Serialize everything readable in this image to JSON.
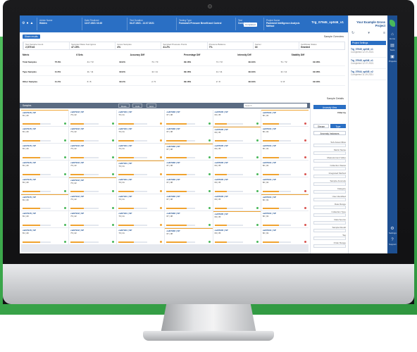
{
  "app": {
    "project_title": "Your Example Gross Project",
    "topbar_title": "Trg_07945_sp046_v1"
  },
  "header": {
    "cells": [
      {
        "key": "Project Name",
        "value": "Pavement Intelligence Analysis Method"
      },
      {
        "key": "Test",
        "value": "Completed"
      },
      {
        "key": "Testing Type",
        "value": "Formwork Pressure Benefit and Control"
      },
      {
        "key": "Test Duration",
        "value": "04.27.2021 - 12.07.2021"
      },
      {
        "key": "Date Finalized",
        "value": "12.07.2021 10:45"
      },
      {
        "key": "Admin Name",
        "value": "Hidden"
      }
    ],
    "tag": "Completed",
    "icons": [
      "bell-icon",
      "user-icon",
      "gear-icon"
    ]
  },
  "sidebar": {
    "rail": [
      {
        "icon": "home-icon",
        "label": "Home"
      },
      {
        "icon": "tests-icon",
        "label": "Tests"
      },
      {
        "icon": "projects-icon",
        "label": "Projects"
      },
      {
        "icon": "settings-icon",
        "label": "Settings"
      },
      {
        "icon": "help-icon",
        "label": "Support"
      }
    ],
    "panel_tab": "Project Settings",
    "projects": [
      {
        "name": "Trg_07945_sp046_v1",
        "sub": "Completed 12.07.2021"
      },
      {
        "name": "Trg_07945_sp046_v1",
        "sub": "Completed 12.07.2021"
      },
      {
        "name": "Trg_07944_sp045_v2",
        "sub": "Completed 11.29.2021"
      }
    ]
  },
  "summary": {
    "button": "Share results",
    "heading": "Sample Overview",
    "metrics": [
      {
        "label": "Test Sample Count",
        "value": "2,575 kit"
      },
      {
        "label": "Sampled Mass Sum/gross",
        "value": "47.15%"
      },
      {
        "label": "Gross Samples",
        "value": "4%"
      },
      {
        "label": "Sampled Pressure Points",
        "value": "41.2%"
      },
      {
        "label": "Pressure Balance",
        "value": "7%"
      },
      {
        "label": "Center",
        "value": "16"
      },
      {
        "label": "Certificate Status",
        "value": "Granted"
      }
    ],
    "stat_headers": [
      "Metric",
      "6 Sets",
      "Accuracy Diff",
      "Percentage Diff",
      "Intensity Diff",
      "Stability Diff"
    ],
    "stat_rows": [
      [
        "Total Samples",
        "75.6%",
        "41 / 72",
        "99.9%",
        "71 / 73",
        "99.18%",
        "71 / 72",
        "99.19%",
        "71 / 72",
        "99.18%"
      ],
      [
        "Type Samples",
        "11.6%",
        "11 / 11",
        "99.9%",
        "11 / 11",
        "99.18%",
        "11 / 11",
        "99.19%",
        "11 / 12",
        "99.18%"
      ],
      [
        "Other Samples",
        "11.4%",
        "6 / 8",
        "99.4%",
        "2 / 5",
        "99.18%",
        "2 / 8",
        "99.19%",
        "3 / 8",
        "99.19%"
      ]
    ],
    "sub_heading": "Sample Details"
  },
  "filters": {
    "header_button": "Anomaly View",
    "section_label": "Filter by",
    "toggle": [
      "Type",
      "Stream"
    ],
    "toggle_on": "Type",
    "second_button": "Anomaly Instances",
    "labels": [
      "Sub-Assemblies",
      "Metric Name",
      "Measurement Value",
      "Collection Status",
      "Integrated Method",
      "Sample Anomaly",
      "Category",
      "User Identified",
      "Date Range",
      "Collection Type",
      "Data Source",
      "Sample Result",
      "Tag",
      "Order Range"
    ]
  },
  "results": {
    "toolbar_label": "Samples",
    "tabs": [
      "Rows",
      "Cols",
      "Grid"
    ],
    "search_placeholder": "Search",
    "cards": [
      {
        "title": "cal07945 | SP",
        "value": "81 | 49",
        "fill": 0.62,
        "status": "#49b85a"
      },
      {
        "title": "cal07942 | SP",
        "value": "76 | 42",
        "fill": 0.48,
        "status": "#49b85a"
      },
      {
        "title": "cal07941 | SP",
        "value": "70 | 41",
        "fill": 0.55,
        "status": "#f0a330"
      },
      {
        "title": "cal07938 | SP",
        "value": "67 | 38",
        "fill": 0.71,
        "status": "#49b85a"
      },
      {
        "title": "cal07935 | SP",
        "value": "63 | 35",
        "fill": 0.44,
        "status": "#49b85a"
      },
      {
        "title": "cal07931 | SP",
        "value": "60 | 31",
        "fill": 0.58,
        "status": "#d9534f"
      }
    ]
  }
}
